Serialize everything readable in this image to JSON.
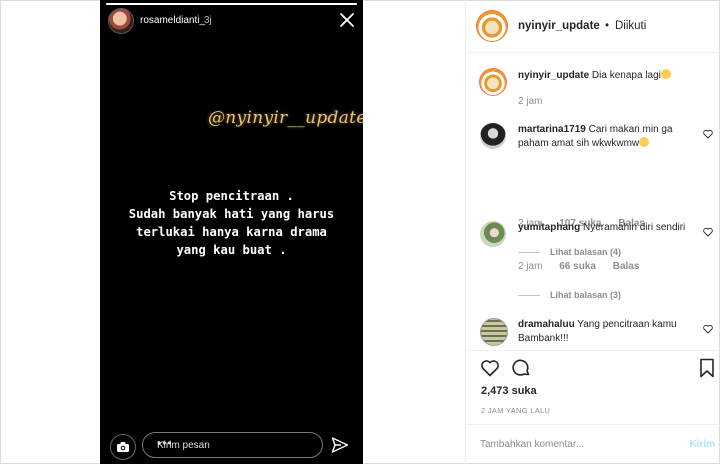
{
  "story": {
    "username": "rosameldianti_",
    "time": "3j",
    "watermark": "@nyinyir__update",
    "text_lines": [
      "Stop pencitraan .",
      "Sudah banyak hati yang harus",
      "terlukai hanya karna drama",
      "yang kau buat ."
    ],
    "message_placeholder": "Kirim pesan",
    "more_dots": "•••"
  },
  "post": {
    "author": "nyinyir_update",
    "separator": "•",
    "follow_status": "Diikuti",
    "likes": "2,473 suka",
    "posted_ago": "2 JAM YANG LALU",
    "add_comment_placeholder": "Tambahkan komentar...",
    "post_button": "Kirim"
  },
  "comments": [
    {
      "user": "nyinyir_update",
      "text": "Dia kenapa lagi",
      "emoji": "grinning-sweat-emoji",
      "time": "2 jam",
      "likes": "",
      "reply": "",
      "view_replies": ""
    },
    {
      "user": "martarina1719",
      "text": "Cari makan min ga paham amat sih wkwkwmw",
      "emoji": "grinning-sweat-emoji",
      "time": "2 jam",
      "likes": "107 suka",
      "reply": "Balas",
      "view_replies": "Lihat balasan (4)"
    },
    {
      "user": "yumitaphang",
      "text": "Nyeramahin diri sendiri",
      "emoji": "",
      "time": "2 jam",
      "likes": "66 suka",
      "reply": "Balas",
      "view_replies": "Lihat balasan (3)"
    },
    {
      "user": "dramahaluu",
      "text": "Yang pencitraan kamu Bambank!!!",
      "emoji": "",
      "time": "",
      "likes": "",
      "reply": "",
      "view_replies": ""
    }
  ],
  "colors": {
    "story_bg": "#000000",
    "watermark": "#e6c27a",
    "text_primary": "#262626",
    "text_secondary": "#8e8e8e",
    "post_button_disabled": "#b2dffc"
  }
}
